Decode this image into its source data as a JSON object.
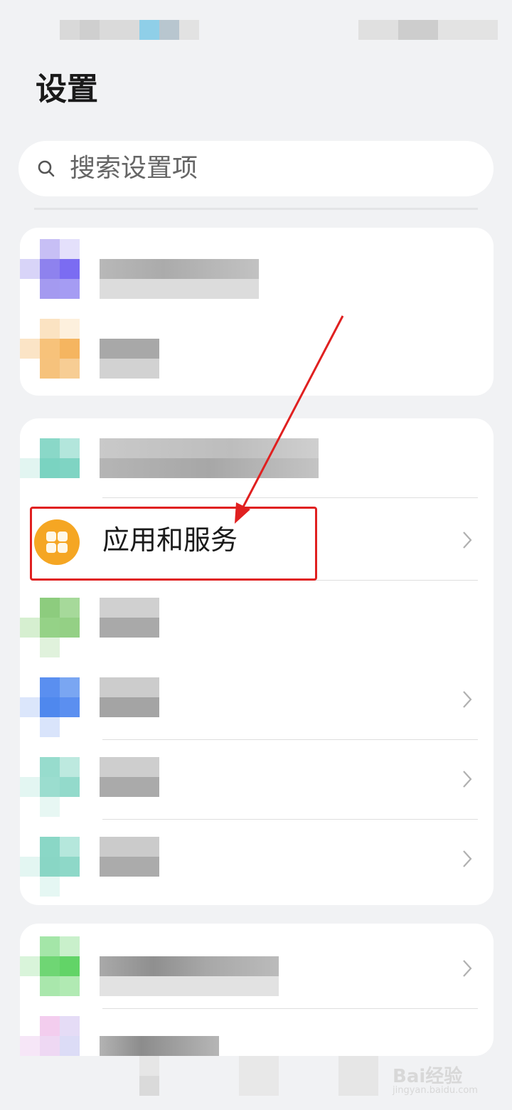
{
  "header": {
    "title": "设置"
  },
  "search": {
    "placeholder": "搜索设置项",
    "icon": "search-icon"
  },
  "highlighted_item": {
    "label": "应用和服务",
    "icon": "apps-icon",
    "icon_color": "#f5a623"
  },
  "annotation": {
    "color": "#e02020"
  },
  "watermark": {
    "brand": "Bai经验",
    "url": "jingyan.baidu.com"
  }
}
